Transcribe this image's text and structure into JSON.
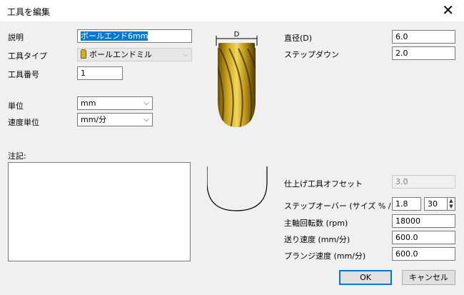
{
  "window": {
    "title": "工具を編集",
    "close_glyph": "✕"
  },
  "form": {
    "description_label": "説明",
    "description_value": "ボールエンド6mm",
    "tool_type_label": "工具タイプ",
    "tool_type_value": "ボールエンドミル",
    "tool_number_label": "工具番号",
    "tool_number_value": "1",
    "unit_label": "単位",
    "unit_value": "mm",
    "speed_unit_label": "速度単位",
    "speed_unit_value": "mm/分",
    "notes_label": "注記:"
  },
  "graphic": {
    "diameter_marker": "D"
  },
  "params": {
    "diameter_label": "直径(D)",
    "diameter_value": "6.0",
    "stepdown_label": "ステップダウン",
    "stepdown_value": "2.0",
    "finish_offset_label": "仕上げ工具オフセット",
    "finish_offset_value": "3.0",
    "stepover_label": "ステップオーバー (サイズ % / D)",
    "stepover_value": "1.8",
    "stepover_percent": "30",
    "spindle_label": "主軸回転数 (rpm)",
    "spindle_value": "18000",
    "feed_label": "送り速度 (mm/分)",
    "feed_value": "600.0",
    "plunge_label": "プランジ速度 (mm/分)",
    "plunge_value": "600.0"
  },
  "buttons": {
    "ok": "OK",
    "cancel": "キャンセル"
  }
}
